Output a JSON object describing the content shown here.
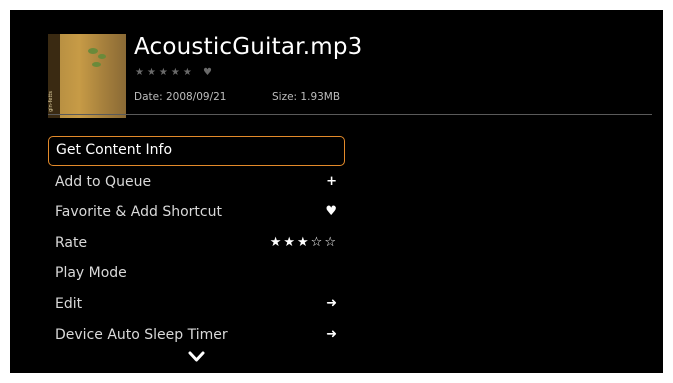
{
  "file": {
    "title": "AcousticGuitar.mp3",
    "rating_stars": "★★★★★",
    "heart": "♥",
    "date": "Date: 2008/09/21",
    "size": "Size: 1.93MB",
    "thumbnail_text": "gin-fetts"
  },
  "menu": {
    "items": [
      {
        "label": "Get Content Info",
        "right": "",
        "icon": ""
      },
      {
        "label": "Add to Queue",
        "right": "+",
        "icon": "plus-icon"
      },
      {
        "label": "Favorite & Add Shortcut",
        "right": "♥",
        "icon": "heart-icon"
      },
      {
        "label": "Rate",
        "right": "★★★☆☆",
        "icon": "rating-stars-icon"
      },
      {
        "label": "Play Mode",
        "right": "",
        "icon": ""
      },
      {
        "label": "Edit",
        "right": "➜",
        "icon": "arrow-right-icon"
      },
      {
        "label": "Device Auto Sleep Timer",
        "right": "➜",
        "icon": "arrow-right-icon"
      }
    ],
    "selected_index": 0
  },
  "colors": {
    "background": "#000000",
    "selection_border": "#e38a2a",
    "text": "#d9d9d9"
  },
  "icons": {
    "scroll_more": "chevron-down-icon"
  }
}
